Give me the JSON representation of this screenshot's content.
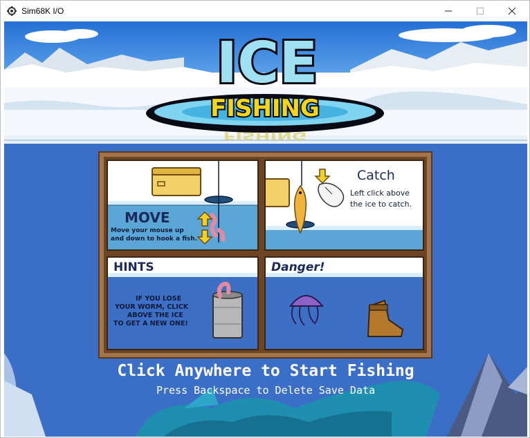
{
  "window": {
    "title": "Sim68K I/O",
    "icon": "gear-icon",
    "controls": [
      "minimize-icon",
      "maximize-icon",
      "close-icon"
    ]
  },
  "game": {
    "logo": {
      "top": "ICE",
      "bottom": "FISHING"
    },
    "panels": {
      "move": {
        "title": "MOVE",
        "text_line1": "Move your mouse up",
        "text_line2": "and down to hook a fish."
      },
      "catch": {
        "title": "Catch",
        "text_line1": "Left click above",
        "text_line2": "the ice to catch."
      },
      "hints": {
        "title": "HINTS",
        "text_line1": "IF YOU LOSE",
        "text_line2": "YOUR WORM, CLICK",
        "text_line3": "ABOVE THE ICE",
        "text_line4": "TO GET A NEW ONE!"
      },
      "danger": {
        "title": "Danger!",
        "icons": [
          "jellyfish-icon",
          "boot-icon"
        ]
      }
    },
    "start_prompt": "Click Anywhere to Start Fishing",
    "delete_prompt": "Press Backspace to Delete Save Data"
  },
  "colors": {
    "water": "#3b6fc7",
    "sky": "#2a73d8",
    "snow": "#f4f8fc",
    "frame": "#a4744a",
    "logo_ice": "#9fe1f3",
    "logo_fishing": "#f3d51c"
  }
}
